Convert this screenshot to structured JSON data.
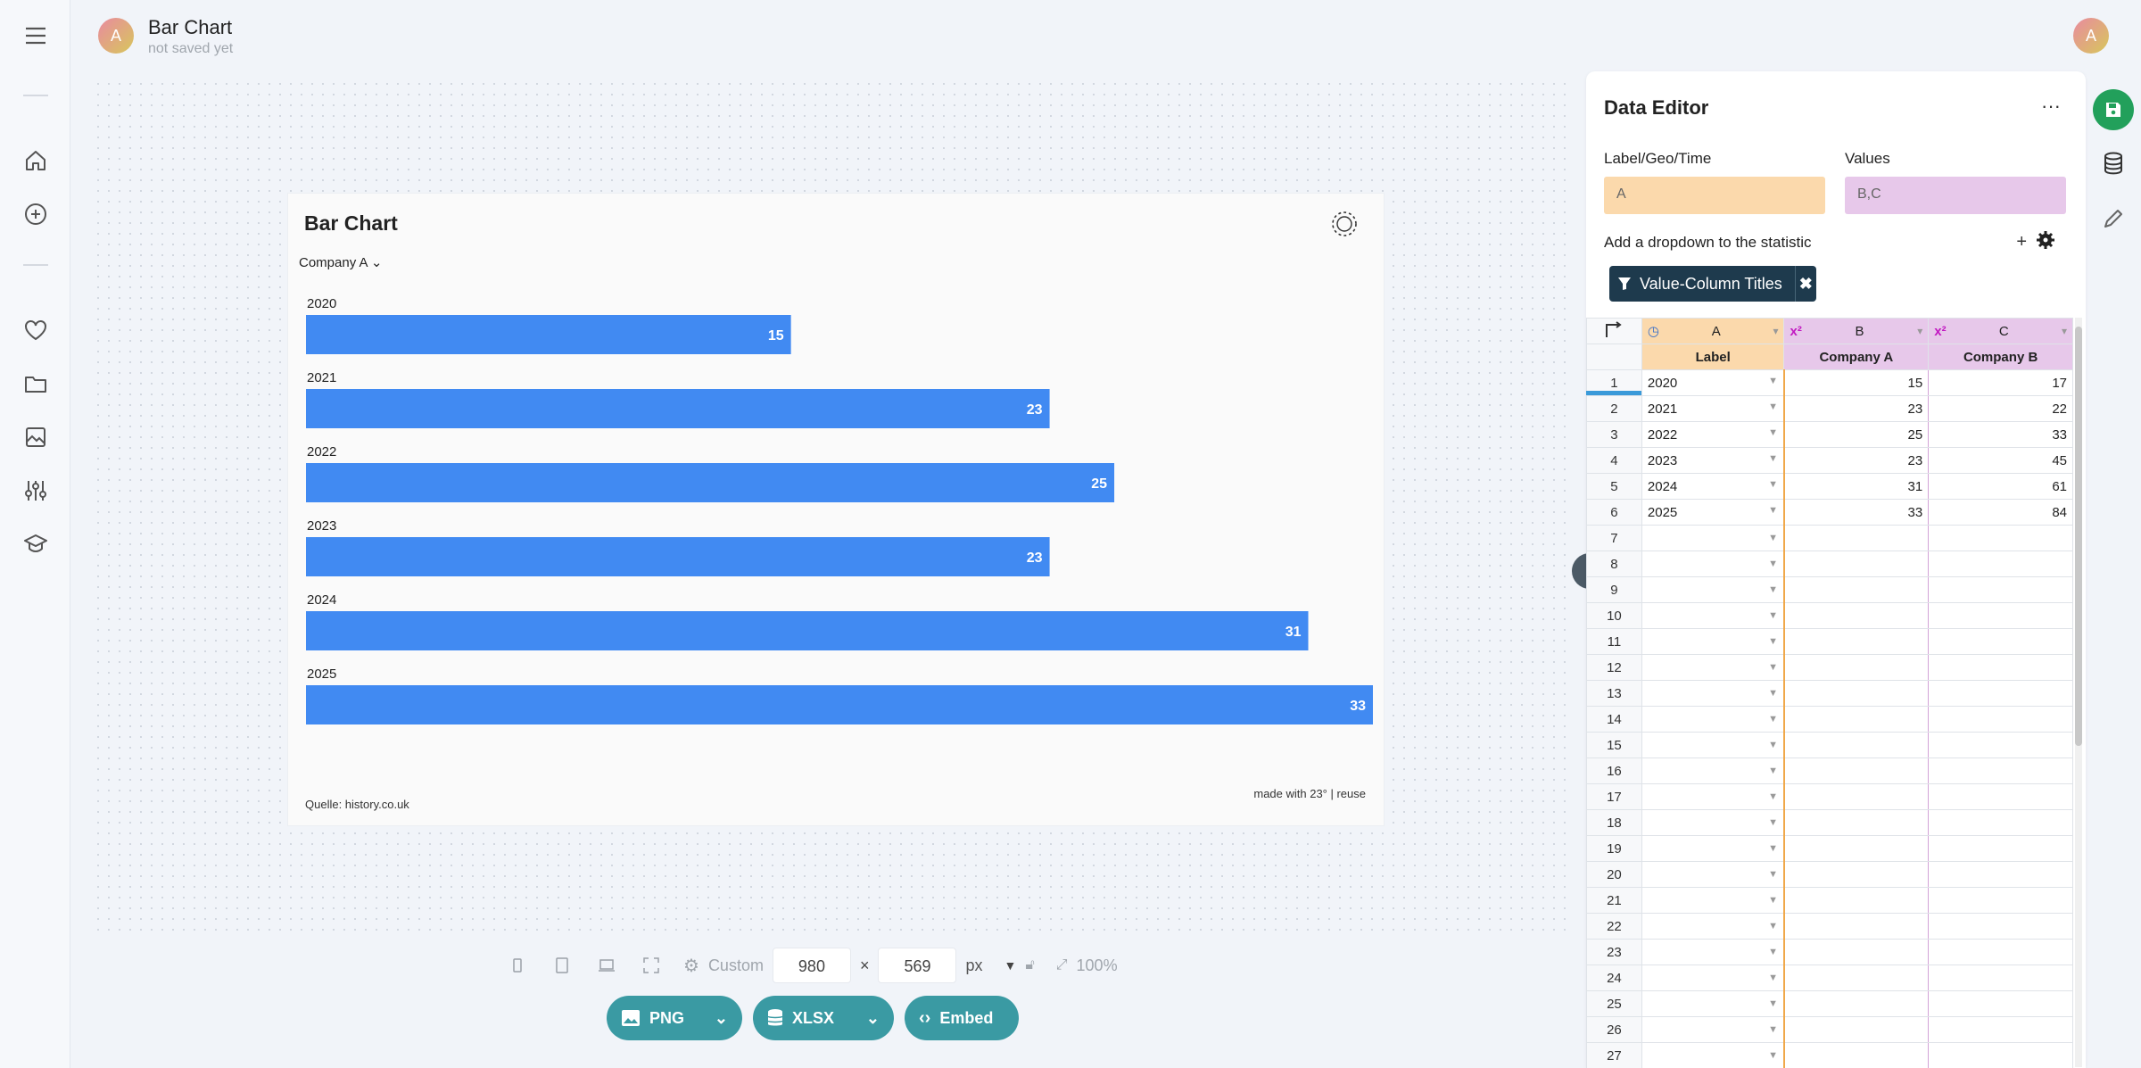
{
  "header": {
    "title": "Bar Chart",
    "subtitle": "not saved yet",
    "avatar_letter": "A"
  },
  "chart": {
    "title": "Bar Chart",
    "dropdown_label": "Company A",
    "source": "Quelle: history.co.uk",
    "made_with": "made with 23° | reuse",
    "logo_text": "23°"
  },
  "chart_data": {
    "type": "bar",
    "orientation": "horizontal",
    "categories": [
      "2020",
      "2021",
      "2022",
      "2023",
      "2024",
      "2025"
    ],
    "values": [
      15,
      23,
      25,
      23,
      31,
      33
    ],
    "title": "Bar Chart",
    "xlim": [
      0,
      33
    ],
    "bar_color": "#418af2",
    "grid": false,
    "data_labels": true
  },
  "size_bar": {
    "preset": "Custom",
    "width": "980",
    "height": "569",
    "unit": "px",
    "zoom": "100%",
    "times": "×"
  },
  "exports": {
    "png": "PNG",
    "xlsx": "XLSX",
    "embed": "Embed"
  },
  "editor": {
    "title": "Data Editor",
    "label_field_title": "Label/Geo/Time",
    "label_field_value": "A",
    "values_field_title": "Values",
    "values_field_value": "B,C",
    "dropdown_text": "Add a dropdown to the statistic",
    "chip_label": "Value-Column Titles",
    "colors": {
      "label": "#fbd9ac",
      "values": "#e7c8ea"
    }
  },
  "grid": {
    "col_letters": [
      "A",
      "B",
      "C"
    ],
    "col_titles": [
      "Label",
      "Company A",
      "Company B"
    ],
    "rows": [
      {
        "n": "1",
        "a": "2020",
        "b": "15",
        "c": "17"
      },
      {
        "n": "2",
        "a": "2021",
        "b": "23",
        "c": "22"
      },
      {
        "n": "3",
        "a": "2022",
        "b": "25",
        "c": "33"
      },
      {
        "n": "4",
        "a": "2023",
        "b": "23",
        "c": "45"
      },
      {
        "n": "5",
        "a": "2024",
        "b": "31",
        "c": "61"
      },
      {
        "n": "6",
        "a": "2025",
        "b": "33",
        "c": "84"
      },
      {
        "n": "7",
        "a": "",
        "b": "",
        "c": ""
      },
      {
        "n": "8",
        "a": "",
        "b": "",
        "c": ""
      },
      {
        "n": "9",
        "a": "",
        "b": "",
        "c": ""
      },
      {
        "n": "10",
        "a": "",
        "b": "",
        "c": ""
      },
      {
        "n": "11",
        "a": "",
        "b": "",
        "c": ""
      },
      {
        "n": "12",
        "a": "",
        "b": "",
        "c": ""
      },
      {
        "n": "13",
        "a": "",
        "b": "",
        "c": ""
      },
      {
        "n": "14",
        "a": "",
        "b": "",
        "c": ""
      },
      {
        "n": "15",
        "a": "",
        "b": "",
        "c": ""
      },
      {
        "n": "16",
        "a": "",
        "b": "",
        "c": ""
      },
      {
        "n": "17",
        "a": "",
        "b": "",
        "c": ""
      },
      {
        "n": "18",
        "a": "",
        "b": "",
        "c": ""
      },
      {
        "n": "19",
        "a": "",
        "b": "",
        "c": ""
      },
      {
        "n": "20",
        "a": "",
        "b": "",
        "c": ""
      },
      {
        "n": "21",
        "a": "",
        "b": "",
        "c": ""
      },
      {
        "n": "22",
        "a": "",
        "b": "",
        "c": ""
      },
      {
        "n": "23",
        "a": "",
        "b": "",
        "c": ""
      },
      {
        "n": "24",
        "a": "",
        "b": "",
        "c": ""
      },
      {
        "n": "25",
        "a": "",
        "b": "",
        "c": ""
      },
      {
        "n": "26",
        "a": "",
        "b": "",
        "c": ""
      },
      {
        "n": "27",
        "a": "",
        "b": "",
        "c": ""
      }
    ]
  }
}
